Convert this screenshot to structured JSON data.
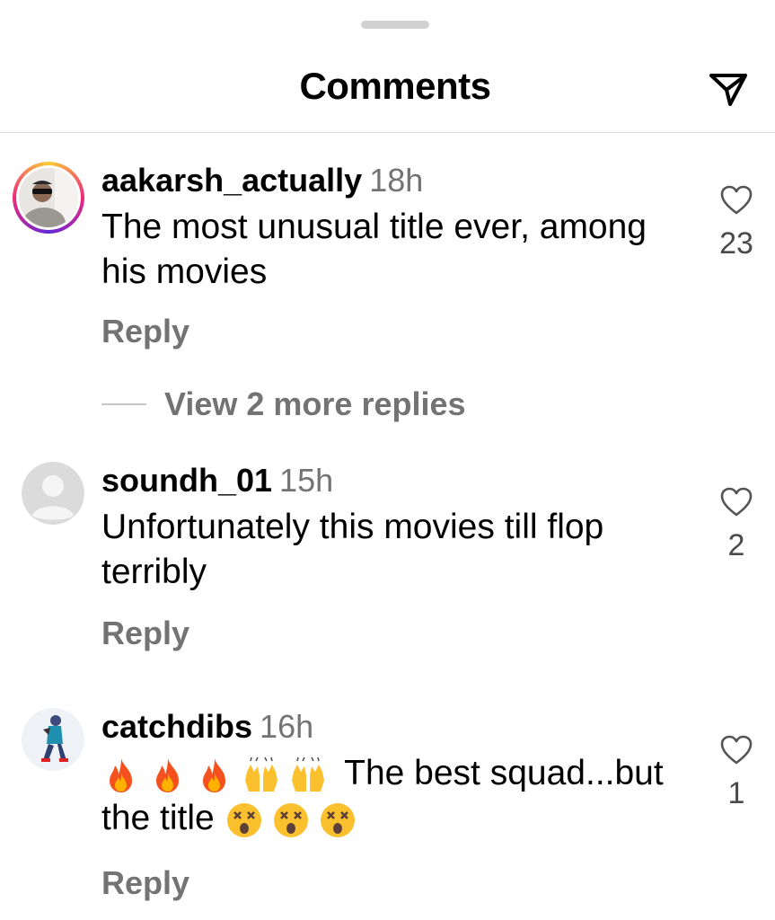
{
  "sheet": {
    "title": "Comments"
  },
  "comments": [
    {
      "username": "aakarsh_actually",
      "time": "18h",
      "text": "The most unusual title ever, among his movies",
      "reply_label": "Reply",
      "likes": "23",
      "view_replies": "View 2 more replies"
    },
    {
      "username": "soundh_01",
      "time": "15h",
      "text": "Unfortunately this movies till flop terribly",
      "reply_label": "Reply",
      "likes": "2"
    },
    {
      "username": "catchdibs",
      "time": "16h",
      "text_after_emoji": "The best squad...but the title",
      "reply_label": "Reply",
      "likes": "1",
      "emojis": [
        "fire",
        "fire",
        "fire",
        "raising-hands",
        "raising-hands"
      ],
      "trailing_emojis": [
        "dizzy-face",
        "dizzy-face",
        "dizzy-face"
      ]
    }
  ],
  "colors": {
    "secondary_text": "#737373",
    "divider": "#dbdbdb",
    "story_ring": "#ee2a7b"
  },
  "icons": [
    "send-icon",
    "heart-icon",
    "fire-emoji",
    "raising-hands-emoji",
    "dizzy-face-emoji"
  ]
}
